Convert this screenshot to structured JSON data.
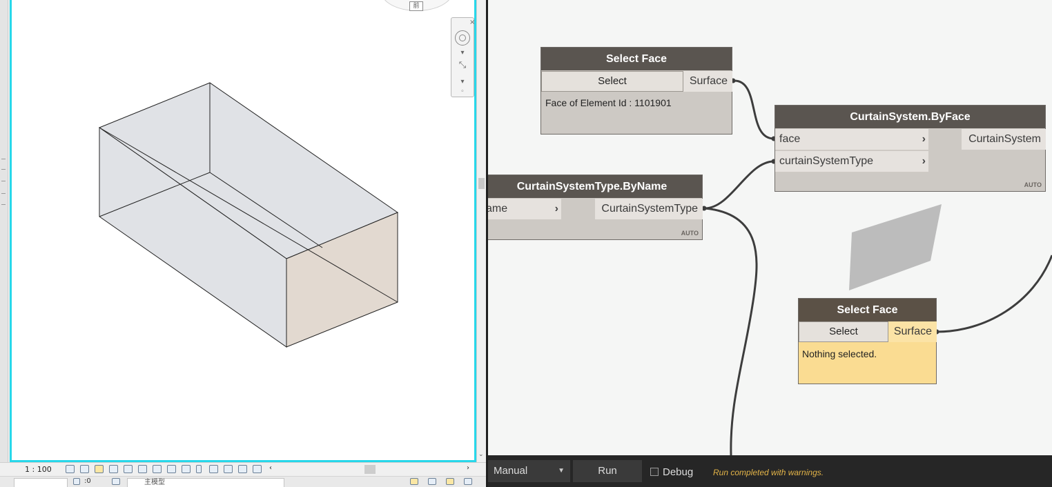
{
  "revit": {
    "view_scale": "1 : 100",
    "status_value": ":0",
    "type_selector": "主模型",
    "viewcube_face": "前"
  },
  "dynamo": {
    "nodes": {
      "select_face_1": {
        "title": "Select Face",
        "button": "Select",
        "output": "Surface",
        "info": "Face of Element Id : 1101901"
      },
      "curtain_by_face": {
        "title": "CurtainSystem.ByFace",
        "inputs": [
          "face",
          "curtainSystemType"
        ],
        "output": "CurtainSystem",
        "lacing": "AUTO"
      },
      "curtain_type_by_name": {
        "title": "CurtainSystemType.ByName",
        "input": "ame",
        "output": "CurtainSystemType",
        "lacing": "AUTO"
      },
      "select_face_2": {
        "title": "Select Face",
        "button": "Select",
        "output": "Surface",
        "info": "Nothing selected."
      }
    },
    "toolbar": {
      "run_mode": "Manual",
      "run_label": "Run",
      "debug_label": "Debug",
      "status": "Run completed with warnings."
    }
  },
  "colors": {
    "viewport_border": "#27d7ea",
    "node_header": "#5a5550",
    "node_body": "#cdc9c4",
    "warning_body": "#fadc92",
    "status_text": "#e3b448"
  }
}
